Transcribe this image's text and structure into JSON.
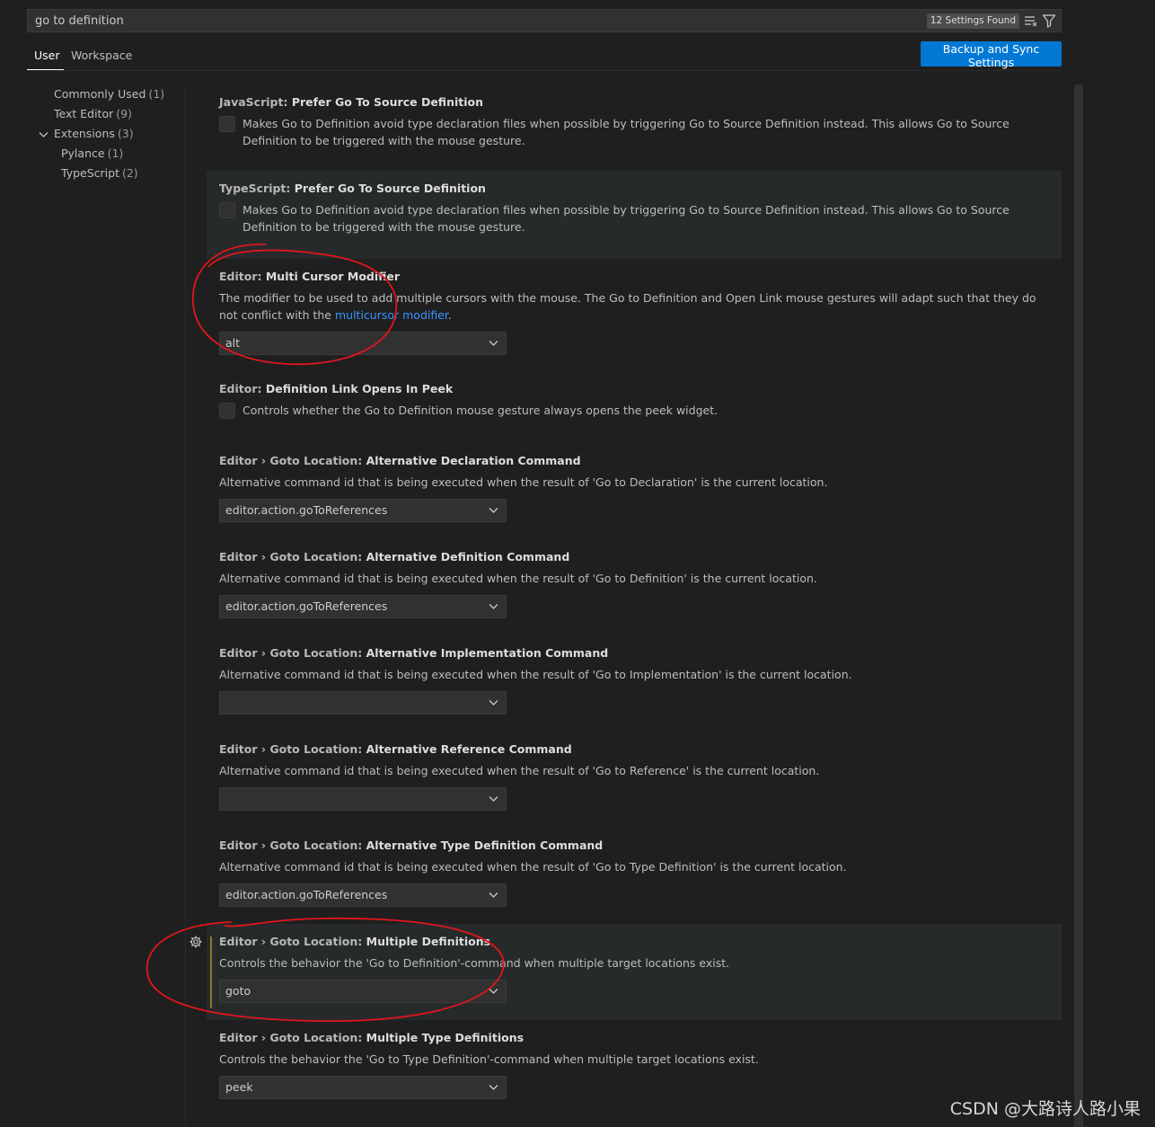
{
  "search": {
    "value": "go to definition",
    "results_badge": "12 Settings Found"
  },
  "tabs": [
    {
      "label": "User"
    },
    {
      "label": "Workspace"
    }
  ],
  "sync_button": "Backup and Sync Settings",
  "toc": [
    {
      "label": "Commonly Used",
      "count": "(1)"
    },
    {
      "label": "Text Editor",
      "count": "(9)"
    },
    {
      "label": "Extensions",
      "count": "(3)"
    },
    {
      "label": "Pylance",
      "count": "(1)"
    },
    {
      "label": "TypeScript",
      "count": "(2)"
    }
  ],
  "settings": [
    {
      "category": "JavaScript: ",
      "name": "Prefer Go To Source Definition",
      "desc": "Makes Go to Definition avoid type declaration files when possible by triggering Go to Source Definition instead. This allows Go to Source Definition to be triggered with the mouse gesture."
    },
    {
      "category": "TypeScript: ",
      "name": "Prefer Go To Source Definition",
      "desc": "Makes Go to Definition avoid type declaration files when possible by triggering Go to Source Definition instead. This allows Go to Source Definition to be triggered with the mouse gesture."
    },
    {
      "category": "Editor: ",
      "name": "Multi Cursor Modifier",
      "desc_pre": "The modifier to be used to add multiple cursors with the mouse. The Go to Definition and Open Link mouse gestures will adapt such that they do not conflict with the ",
      "desc_link": "multicursor modifier",
      "desc_post": ".",
      "value": "alt"
    },
    {
      "category": "Editor: ",
      "name": "Definition Link Opens In Peek",
      "desc": "Controls whether the Go to Definition mouse gesture always opens the peek widget."
    },
    {
      "category": "Editor › Goto Location: ",
      "name": "Alternative Declaration Command",
      "desc": "Alternative command id that is being executed when the result of 'Go to Declaration' is the current location.",
      "value": "editor.action.goToReferences"
    },
    {
      "category": "Editor › Goto Location: ",
      "name": "Alternative Definition Command",
      "desc": "Alternative command id that is being executed when the result of 'Go to Definition' is the current location.",
      "value": "editor.action.goToReferences"
    },
    {
      "category": "Editor › Goto Location: ",
      "name": "Alternative Implementation Command",
      "desc": "Alternative command id that is being executed when the result of 'Go to Implementation' is the current location.",
      "value": ""
    },
    {
      "category": "Editor › Goto Location: ",
      "name": "Alternative Reference Command",
      "desc": "Alternative command id that is being executed when the result of 'Go to Reference' is the current location.",
      "value": ""
    },
    {
      "category": "Editor › Goto Location: ",
      "name": "Alternative Type Definition Command",
      "desc": "Alternative command id that is being executed when the result of 'Go to Type Definition' is the current location.",
      "value": "editor.action.goToReferences"
    },
    {
      "category": "Editor › Goto Location: ",
      "name": "Multiple Definitions",
      "desc": "Controls the behavior the 'Go to Definition'-command when multiple target locations exist.",
      "value": "goto"
    },
    {
      "category": "Editor › Goto Location: ",
      "name": "Multiple Type Definitions",
      "desc": "Controls the behavior the 'Go to Type Definition'-command when multiple target locations exist.",
      "value": "peek"
    }
  ],
  "watermark": "CSDN @大路诗人路小果",
  "colors": {
    "accent": "#0078d4",
    "link": "#3794ff",
    "annotation": "#e0161b",
    "modified_bar": "#8a7a2a"
  }
}
